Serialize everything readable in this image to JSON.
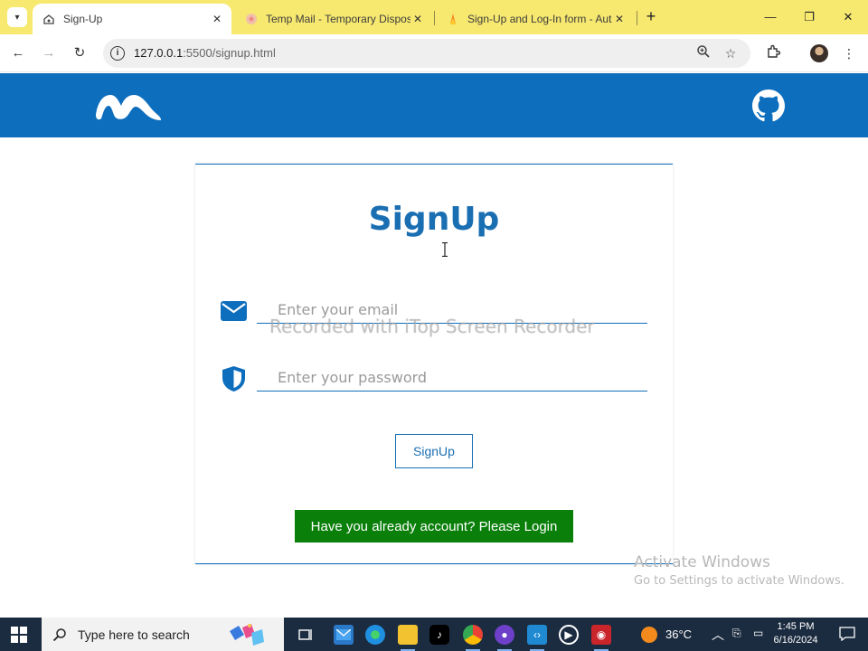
{
  "browser": {
    "tabs": [
      {
        "title": "Sign-Up",
        "active": true
      },
      {
        "title": "Temp Mail - Temporary Dispos",
        "active": false
      },
      {
        "title": "Sign-Up and Log-In form - Aut",
        "active": false
      }
    ],
    "address": {
      "host": "127.0.0.1",
      "rest": ":5500/signup.html"
    }
  },
  "page": {
    "title": "SignUp",
    "email_placeholder": "Enter your email",
    "password_placeholder": "Enter your password",
    "signup_button": "SignUp",
    "login_button": "Have you already account? Please Login",
    "brand_color": "#0d6ebd",
    "login_color": "#0a7f0a"
  },
  "overlay": {
    "watermark": "Recorded with iTop Screen Recorder",
    "activate_line1": "Activate Windows",
    "activate_line2": "Go to Settings to activate Windows."
  },
  "taskbar": {
    "search_placeholder": "Type here to search",
    "temperature": "36°C",
    "time": "1:45 PM",
    "date": "6/16/2024"
  },
  "icons": [
    "chevron-down-icon",
    "globe-icon",
    "close-icon",
    "plus-icon",
    "minimize-icon",
    "restore-icon",
    "back-icon",
    "forward-icon",
    "reload-icon",
    "info-icon",
    "zoom-icon",
    "star-icon",
    "extensions-icon",
    "more-icon",
    "logo-icon",
    "github-icon",
    "envelope-icon",
    "shield-icon",
    "windows-icon",
    "search-icon"
  ]
}
